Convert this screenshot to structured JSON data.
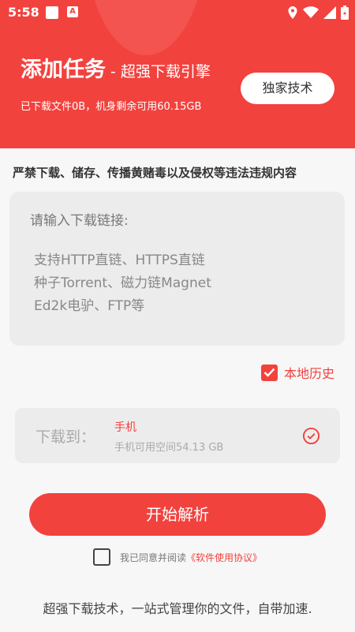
{
  "status": {
    "time": "5:58",
    "app_icon_letter": "A"
  },
  "header": {
    "title": "添加任务",
    "subtitle": "- 超强下载引擎",
    "storage_info": "已下载文件0B，机身剩余可用60.15GB",
    "exclusive_button": "独家技术"
  },
  "warning": "严禁下载、储存、传播黄赌毒以及侵权等违法违规内容",
  "input": {
    "label": "请输入下载链接:",
    "hint_lines": [
      "支持HTTP直链、HTTPS直链",
      "种子Torrent、磁力链Magnet",
      "Ed2k电驴、FTP等"
    ]
  },
  "history": {
    "label": "本地历史",
    "checked": true
  },
  "destination": {
    "label": "下载到：",
    "name": "手机",
    "space": "手机可用空间54.13 GB"
  },
  "start_button": "开始解析",
  "agreement": {
    "prefix": "我已同意并阅读",
    "link": "《软件使用协议》",
    "checked": false
  },
  "footer": "超强下载技术，一站式管理你的文件，自带加速.",
  "colors": {
    "accent": "#f2423e",
    "background": "#f7f7f7",
    "panel": "#ececec"
  }
}
